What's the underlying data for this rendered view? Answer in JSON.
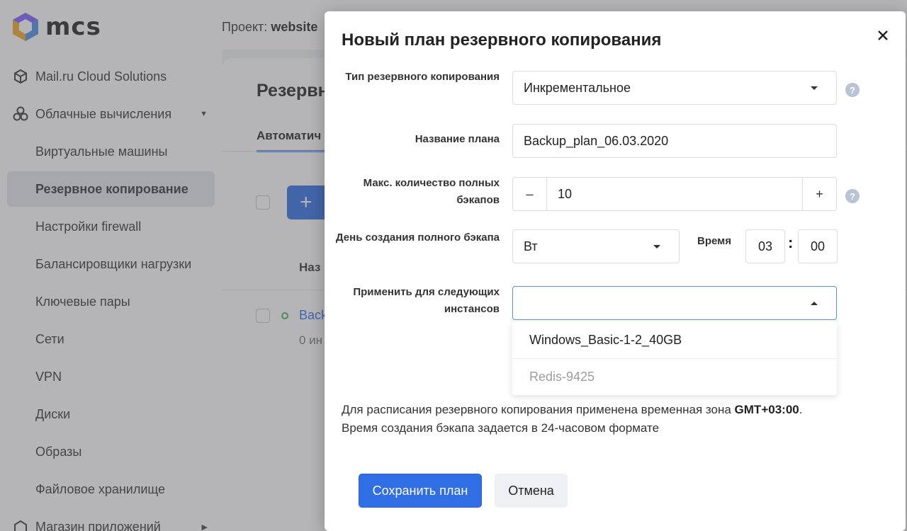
{
  "app": {
    "logo_text": "mcs",
    "project_label": "Проект:",
    "project_name": "website"
  },
  "sidebar": {
    "items": [
      {
        "label": "Mail.ru Cloud Solutions",
        "icon": "cube-icon"
      },
      {
        "label": "Облачные вычисления",
        "icon": "cloud-nodes-icon"
      },
      {
        "label": "Виртуальные машины"
      },
      {
        "label": "Резервное копирование"
      },
      {
        "label": "Настройки firewall"
      },
      {
        "label": "Балансировщики нагрузки"
      },
      {
        "label": "Ключевые пары"
      },
      {
        "label": "Сети"
      },
      {
        "label": "VPN"
      },
      {
        "label": "Диски"
      },
      {
        "label": "Образы"
      },
      {
        "label": "Файловое хранилище"
      },
      {
        "label": "Магазин приложений",
        "icon": "store-icon"
      }
    ]
  },
  "main": {
    "title": "Резервн",
    "tab": "Автоматич",
    "column_header": "Наз",
    "row_name": "Back",
    "row_sub": "0 ин",
    "add_icon": "plus-icon",
    "add_label": "+"
  },
  "modal": {
    "title": "Новый план резервного копирования",
    "close_icon": "close-icon",
    "fields": {
      "backup_type": {
        "label": "Тип резервного копирования",
        "value": "Инкрементальное"
      },
      "plan_name": {
        "label": "Название плана",
        "value": "Backup_plan_06.03.2020"
      },
      "max_full": {
        "label": "Макс. количество полных бэкапов",
        "value": "10",
        "minus": "–",
        "plus": "+"
      },
      "full_day": {
        "label": "День создания полного бэкапа",
        "value": "Вт"
      },
      "time": {
        "label": "Время",
        "hours": "03",
        "colon": ":",
        "minutes": "00"
      },
      "instances": {
        "label": "Применить для следующих инстансов",
        "value": "",
        "options": [
          "Windows_Basic-1-2_40GB",
          "Redis-9425"
        ]
      }
    },
    "help_label": "?",
    "note_part1": "Для расписания резервного копирования применена временная зона ",
    "note_tz": "GMT+03:00",
    "note_part2": ".",
    "note_line2": "Время создания бэкапа задается в 24-часовом формате",
    "save_label": "Сохранить план",
    "cancel_label": "Отмена"
  },
  "colors": {
    "accent": "#2f6ee5",
    "status_green": "#3fb34f",
    "help_bg": "#b9c3d6"
  }
}
